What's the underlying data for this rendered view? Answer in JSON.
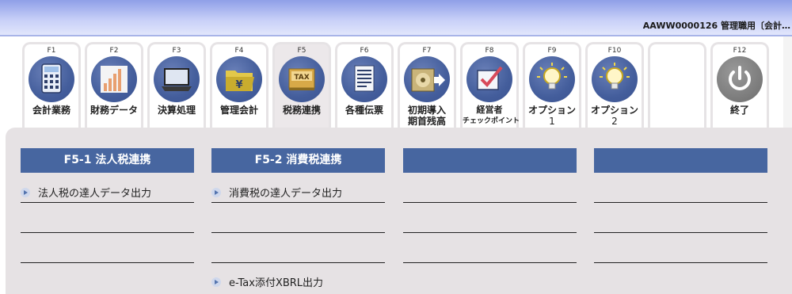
{
  "header": {
    "title": "AAWW0000126 管理職用〔会計…"
  },
  "function_keys": [
    {
      "key": "F1",
      "label": "会計業務",
      "icon": "calculator-icon"
    },
    {
      "key": "F2",
      "label": "財務データ",
      "icon": "bar-chart-icon"
    },
    {
      "key": "F3",
      "label": "決算処理",
      "icon": "laptop-icon"
    },
    {
      "key": "F4",
      "label": "管理会計",
      "icon": "yen-folder-icon"
    },
    {
      "key": "F5",
      "label": "税務連携",
      "icon": "tax-box-icon"
    },
    {
      "key": "F6",
      "label": "各種伝票",
      "icon": "document-icon"
    },
    {
      "key": "F7",
      "label_line1": "初期導入",
      "label_line2": "期首残高",
      "icon": "disk-import-icon"
    },
    {
      "key": "F8",
      "label_line1": "経営者",
      "label_line2": "チェックポイント",
      "icon": "checkbox-icon"
    },
    {
      "key": "F9",
      "label_line1": "オプション",
      "label_line2": "1",
      "icon": "lightbulb-icon"
    },
    {
      "key": "F10",
      "label_line1": "オプション",
      "label_line2": "2",
      "icon": "lightbulb-icon"
    },
    {
      "key": "F12",
      "label": "終了",
      "icon": "power-icon"
    }
  ],
  "columns": [
    {
      "title": "F5-1 法人税連携",
      "items": [
        "法人税の達人データ出力"
      ]
    },
    {
      "title": "F5-2 消費税連携",
      "items": [
        "消費税の達人データ出力"
      ],
      "extra": "e-Tax添付XBRL出力"
    },
    {
      "title": "",
      "items": []
    },
    {
      "title": "",
      "items": []
    }
  ]
}
